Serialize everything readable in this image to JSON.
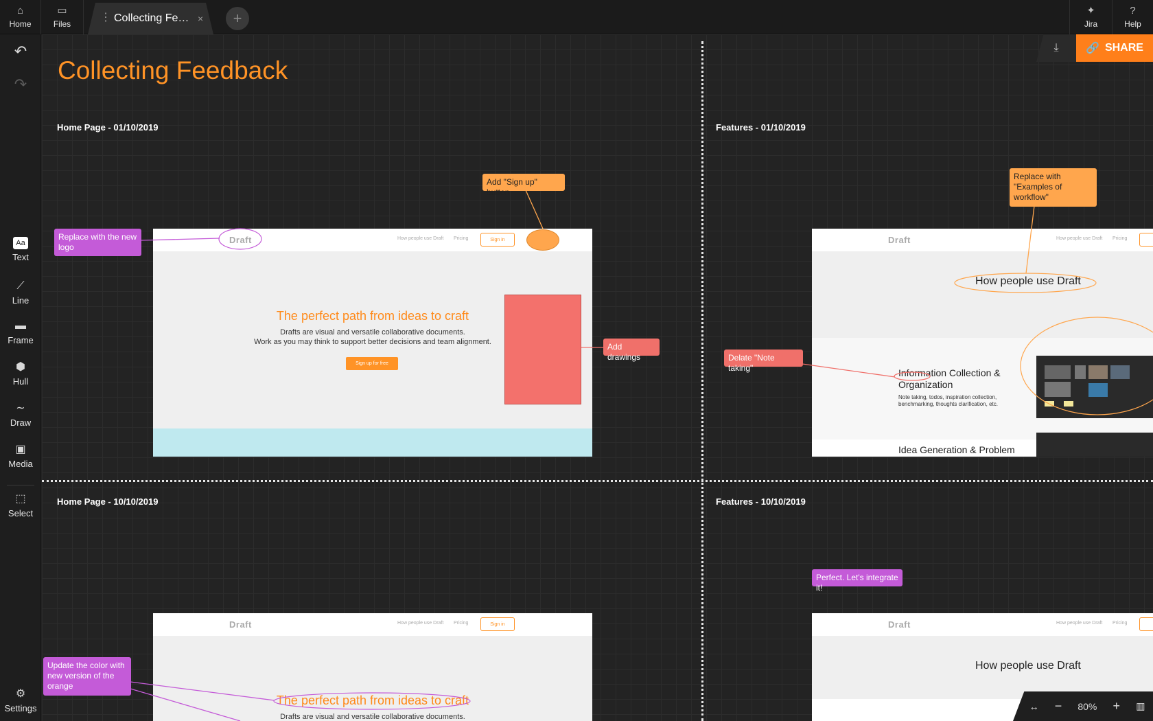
{
  "topbar": {
    "home_label": "Home",
    "files_label": "Files",
    "tab_title": "Collecting Fee...",
    "tab_close": "×",
    "new_tab": "+",
    "jira_label": "Jira",
    "help_label": "Help"
  },
  "sidebar": {
    "text_icon": "Aa",
    "items": [
      {
        "label": "Text",
        "icon": "text-icon"
      },
      {
        "label": "Line",
        "icon": "line-icon"
      },
      {
        "label": "Frame",
        "icon": "frame-icon"
      },
      {
        "label": "Hull",
        "icon": "hull-icon"
      },
      {
        "label": "Draw",
        "icon": "draw-icon"
      },
      {
        "label": "Media",
        "icon": "media-icon"
      },
      {
        "label": "Select",
        "icon": "select-icon"
      }
    ],
    "settings_label": "Settings"
  },
  "board": {
    "title": "Collecting Feedback",
    "sections": [
      "Home Page - 01/10/2019",
      "Features - 01/10/2019",
      "Home Page - 10/10/2019",
      "Features - 10/10/2019"
    ]
  },
  "frames": {
    "logo": "Draft",
    "nav_link1": "How people use Draft",
    "nav_link2": "Pricing",
    "sign_in": "Sign in",
    "hero_title": "The perfect path from ideas to craft",
    "hero_sub1": "Drafts are visual and versatile collaborative documents.",
    "hero_sub2": "Work as you may think to support better decisions and team alignment.",
    "hero_button": "Sign up for free",
    "features_heading": "How people use Draft",
    "feature1_title": "Information Collection & Organization",
    "feature1_text": "Note taking, todos, inspiration collection, benchmarking, thoughts clarification, etc.",
    "feature2_title": "Idea Generation & Problem"
  },
  "notes": {
    "replace_logo": "Replace with the new logo",
    "add_signup": "Add \"Sign up\" button",
    "add_drawings": "Add drawings",
    "replace_examples": "Replace with \"Examples of workflow\"",
    "delete_note": "Delate \"Note taking\"",
    "update_color": "Update the color with new version of the orange",
    "perfect": "Perfect. Let's integrate it!"
  },
  "toolbar": {
    "share_label": "SHARE",
    "zoom": "80%",
    "zoom_out": "−",
    "zoom_in": "+"
  },
  "colors": {
    "accent": "#ff9326",
    "purple_note": "#c45bd8",
    "orange_note": "#ffa64d",
    "red_note": "#f0706a"
  }
}
